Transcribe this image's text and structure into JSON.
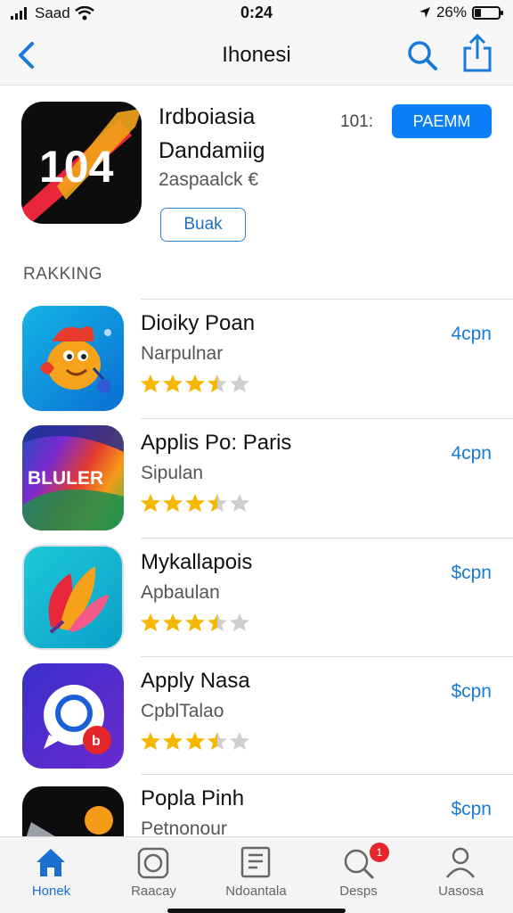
{
  "status_bar": {
    "carrier": "Saad",
    "time": "0:24",
    "battery": "26%",
    "battery_level": 0.26
  },
  "nav": {
    "title": "Ihonesi"
  },
  "featured": {
    "title_line1": "Irdboiasia",
    "title_line2": "Dandamiig",
    "subtitle": "2aspaalck €",
    "outline_button": "Buak",
    "count": "101:",
    "primary_button": "PAEMM",
    "icon_text": "104"
  },
  "section": {
    "title": "RAKKING"
  },
  "apps": [
    {
      "name": "Dioiky Poan",
      "category": "Narpulnar",
      "price": "4cpn",
      "rating": 3.5,
      "icon": "fish-character-icon"
    },
    {
      "name": "Applis Po: Paris",
      "category": "Sipulan",
      "price": "4cpn",
      "rating": 3.5,
      "icon_text": "BLULER",
      "icon": "bluler-app-icon"
    },
    {
      "name": "Mykallapois",
      "category": "Apbaulan",
      "price": "$cpn",
      "rating": 3.5,
      "icon": "colorful-leaf-icon"
    },
    {
      "name": "Apply Nasa",
      "category": "CpblTalao",
      "price": "$cpn",
      "rating": 3.5,
      "icon_text": "b",
      "icon": "chat-bubble-icon"
    },
    {
      "name": "Popla Pinh",
      "category": "Petnonour",
      "price": "$cpn",
      "icon": "pen-app-icon"
    }
  ],
  "tabs": [
    {
      "label": "Honek",
      "icon": "home-icon",
      "active": true
    },
    {
      "label": "Raacay",
      "icon": "camera-icon",
      "active": false
    },
    {
      "label": "Ndoantala",
      "icon": "document-icon",
      "active": false
    },
    {
      "label": "Desps",
      "icon": "search-icon",
      "active": false,
      "badge": "1"
    },
    {
      "label": "Uasosa",
      "icon": "person-icon",
      "active": false
    }
  ],
  "colors": {
    "accent": "#0a7ff5",
    "star": "#f5b700",
    "badge": "#e5262a"
  }
}
